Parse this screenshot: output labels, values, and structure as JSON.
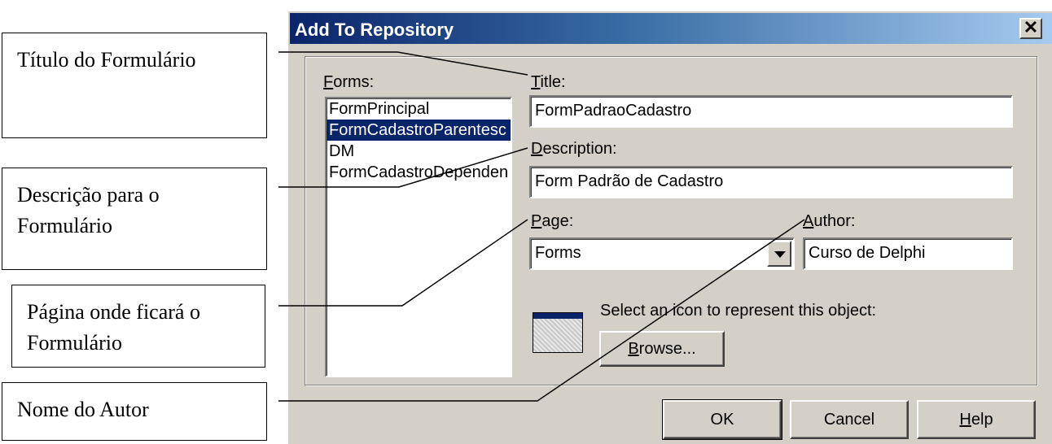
{
  "dialog": {
    "title": "Add To Repository",
    "close_glyph": "✕",
    "forms_label_accel": "F",
    "forms_label_rest": "orms:",
    "forms": [
      "FormPrincipal",
      "FormCadastroParentesc",
      "DM",
      "FormCadastroDependen"
    ],
    "selected_form_index": 1,
    "title_label_accel": "T",
    "title_label_rest": "itle:",
    "title_value": "FormPadraoCadastro",
    "description_label_accel": "D",
    "description_label_rest": "escription:",
    "description_value": "Form Padrão de Cadastro",
    "page_label_accel": "P",
    "page_label_rest": "age:",
    "page_value": "Forms",
    "author_label_accel": "A",
    "author_label_rest": "uthor:",
    "author_value": "Curso de Delphi",
    "icon_prompt": "Select an icon to represent this object:",
    "browse_accel": "B",
    "browse_rest": "rowse...",
    "ok_label": "OK",
    "cancel_label": "Cancel",
    "help_accel": "H",
    "help_rest": "elp"
  },
  "callouts": {
    "title": "Título do Formulário",
    "description": "Descrição para o\nFormulário",
    "page": "Página onde ficará o\nFormulário",
    "author": "Nome do Autor"
  },
  "colors": {
    "titlebar_start": "#0a246a",
    "titlebar_end": "#a6caf0",
    "dialog_face": "#d4d0c8",
    "selection": "#0a246a"
  }
}
